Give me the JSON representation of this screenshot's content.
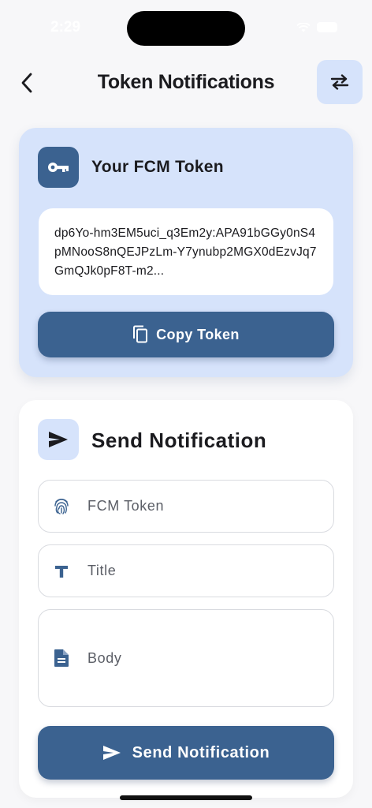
{
  "status_bar": {
    "time": "2:29"
  },
  "header": {
    "title": "Token Notifications"
  },
  "token_card": {
    "title": "Your FCM Token",
    "token": "dp6Yo-hm3EM5uci_q3Em2y:APA91bGGy0nS4pMNooS8nQEJPzLm-Y7ynubp2MGX0dEzvJq7GmQJk0pF8T-m2...",
    "copy_label": "Copy Token"
  },
  "send_card": {
    "title": "Send Notification",
    "fields": {
      "token_placeholder": "FCM Token",
      "title_placeholder": "Title",
      "body_placeholder": "Body"
    },
    "send_label": "Send Notification"
  },
  "colors": {
    "primary": "#3b6290",
    "primary_container": "#d6e3fb",
    "background": "#f7f7f9",
    "surface": "#ffffff"
  },
  "icons": {
    "back": "chevron-left-icon",
    "swap": "swap-arrows-icon",
    "key": "key-icon",
    "copy": "copy-icon",
    "send": "send-icon",
    "fingerprint": "fingerprint-icon",
    "title": "text-title-icon",
    "body": "document-icon"
  }
}
